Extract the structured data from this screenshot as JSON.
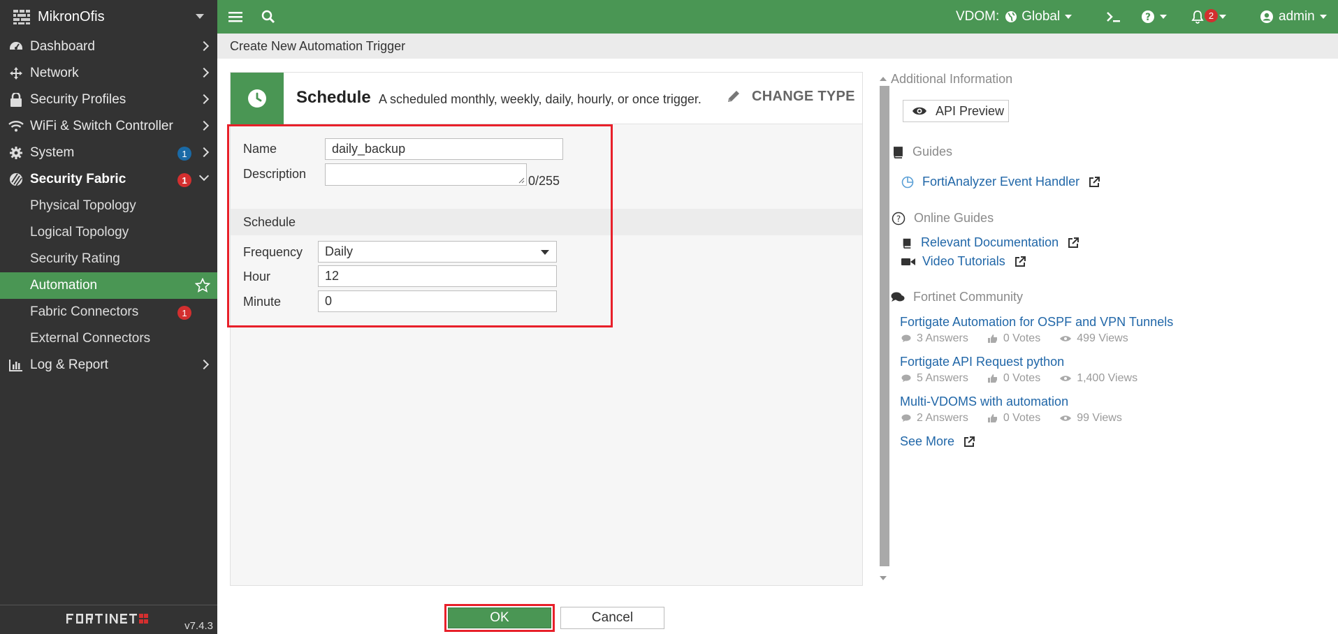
{
  "brand": {
    "name": "MikronOfis"
  },
  "sidebar": {
    "items": [
      {
        "label": "Dashboard"
      },
      {
        "label": "Network"
      },
      {
        "label": "Security Profiles"
      },
      {
        "label": "WiFi & Switch Controller"
      },
      {
        "label": "System",
        "badge": "1"
      },
      {
        "label": "Security Fabric",
        "badge": "1"
      }
    ],
    "subitems": [
      {
        "label": "Physical Topology"
      },
      {
        "label": "Logical Topology"
      },
      {
        "label": "Security Rating"
      },
      {
        "label": "Automation"
      },
      {
        "label": "Fabric Connectors",
        "badge": "1"
      },
      {
        "label": "External Connectors"
      }
    ],
    "log_report": "Log & Report",
    "version": "v7.4.3"
  },
  "topbar": {
    "vdom_label": "VDOM:",
    "vdom_value": "Global",
    "notifications": "2",
    "user": "admin"
  },
  "page": {
    "title": "Create New Automation Trigger"
  },
  "trigger": {
    "type": "Schedule",
    "description": "A scheduled monthly, weekly, daily, hourly, or once trigger.",
    "change_type": "CHANGE TYPE"
  },
  "form": {
    "name_label": "Name",
    "name_value": "daily_backup",
    "description_label": "Description",
    "description_value": "",
    "description_count": "0/255",
    "section_schedule": "Schedule",
    "frequency_label": "Frequency",
    "frequency_value": "Daily",
    "hour_label": "Hour",
    "hour_value": "12",
    "minute_label": "Minute",
    "minute_value": "0"
  },
  "info": {
    "additional": "Additional Information",
    "api_preview": "API Preview",
    "guides": "Guides",
    "guide_link": "FortiAnalyzer Event Handler",
    "online_guides": "Online Guides",
    "relevant_docs": "Relevant Documentation",
    "video_tutorials": "Video Tutorials",
    "community": "Fortinet Community",
    "posts": [
      {
        "title": "Fortigate Automation for OSPF and VPN Tunnels",
        "answers": "3  Answers",
        "votes": "0  Votes",
        "views": "499  Views"
      },
      {
        "title": "Fortigate API Request python",
        "answers": "5  Answers",
        "votes": "0  Votes",
        "views": "1,400  Views"
      },
      {
        "title": "Multi-VDOMS with automation",
        "answers": "2  Answers",
        "votes": "0  Votes",
        "views": "99  Views"
      }
    ],
    "see_more": "See More"
  },
  "buttons": {
    "ok": "OK",
    "cancel": "Cancel"
  },
  "colors": {
    "accent_green": "#4a9654",
    "sidebar_bg": "#333333",
    "badge_red": "#d32f2f",
    "badge_blue": "#1a6aa6",
    "link_blue": "#2167a8",
    "highlight_red": "#e8202a"
  }
}
